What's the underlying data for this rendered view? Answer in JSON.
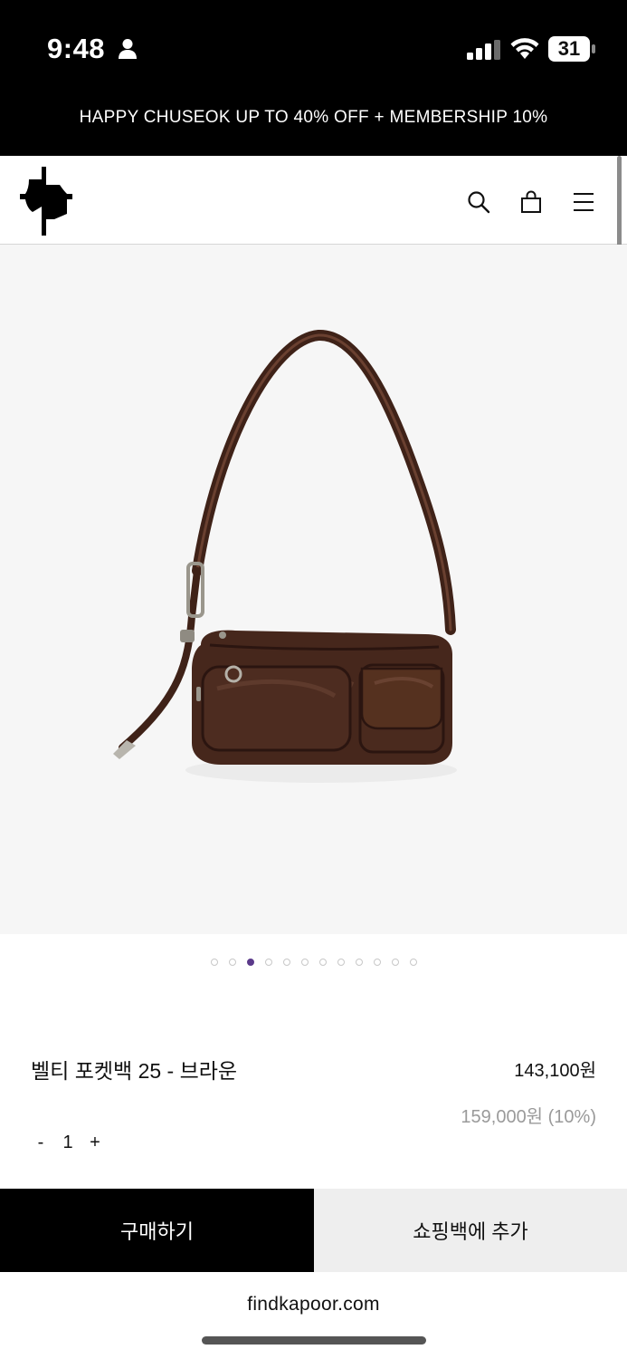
{
  "status_bar": {
    "time": "9:48",
    "battery": "31",
    "icons": [
      "person-icon",
      "signal-icon",
      "wifi-icon",
      "battery-icon"
    ]
  },
  "promo_banner": {
    "text": "HAPPY CHUSEOK UP TO 40% OFF + MEMBERSHIP 10%"
  },
  "header": {
    "icons": [
      "logo",
      "search-icon",
      "shopping-bag-icon",
      "menu-icon"
    ]
  },
  "product": {
    "image": "brown-leather-pocket-shoulder-bag",
    "name": "벨티 포켓백 25 - 브라운",
    "price": "143,100원",
    "original_price": "159,000원 (10%)",
    "quantity": {
      "minus": "-",
      "value": "1",
      "plus": "+"
    }
  },
  "carousel": {
    "total": 12,
    "active_index": 2
  },
  "actions": {
    "buy_label": "구매하기",
    "add_to_bag_label": "쇼핑백에 추가"
  },
  "browser": {
    "url": "findkapoor.com"
  },
  "colors": {
    "banner_bg": "#000000",
    "buy_bg": "#000000",
    "add_bag_bg": "#eeeeee",
    "active_dot": "#5b3a8a",
    "image_bg": "#f6f6f6",
    "bag_brown": "#4a2a1e"
  }
}
